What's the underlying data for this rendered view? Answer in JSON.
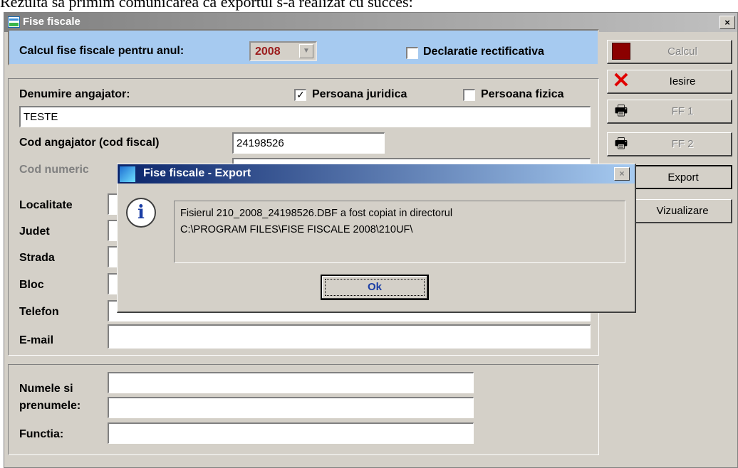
{
  "document": {
    "caption_line": "Rezultă să primim comunicarea că exportul s-a realizat cu succes:"
  },
  "window": {
    "title": "Fise fiscale",
    "close_glyph": "×"
  },
  "header": {
    "calc_label": "Calcul fise fiscale pentru anul:",
    "year": "2008",
    "rectificativa_label": "Declaratie rectificativa",
    "rectificativa_checked": false
  },
  "employer": {
    "name_label": "Denumire angajator:",
    "name_value": "TESTE",
    "juridica_label": "Persoana juridica",
    "juridica_checked": true,
    "fizica_label": "Persoana fizica",
    "fizica_checked": false,
    "cod_label": "Cod angajator (cod fiscal)",
    "cod_value": "24198526",
    "cnp_label": "Cod numeric",
    "localitate_label": "Localitate",
    "judet_label": "Judet",
    "strada_label": "Strada",
    "bloc_label": "Bloc",
    "telefon_label": "Telefon",
    "email_label": "E-mail"
  },
  "signer": {
    "nume_label_1": "Numele si",
    "nume_label_2": "prenumele:",
    "functia_label": "Functia:"
  },
  "toolbar": {
    "calcul": "Calcul",
    "iesire": "Iesire",
    "ff1": "FF 1",
    "ff2": "FF 2",
    "export": "Export",
    "vizualizare": "Vizualizare"
  },
  "dialog": {
    "title": "Fise fiscale - Export",
    "message_line1": "Fisierul 210_2008_24198526.DBF a fost copiat in directorul",
    "message_line2": "C:\\PROGRAM FILES\\FISE FISCALE 2008\\210UF\\",
    "ok_label": "Ok",
    "close_glyph": "×",
    "info_glyph": "i"
  },
  "colors": {
    "accent_blue": "#a6caf0",
    "dialog_title": "#0a246a",
    "year_text": "#9b1b1b"
  }
}
